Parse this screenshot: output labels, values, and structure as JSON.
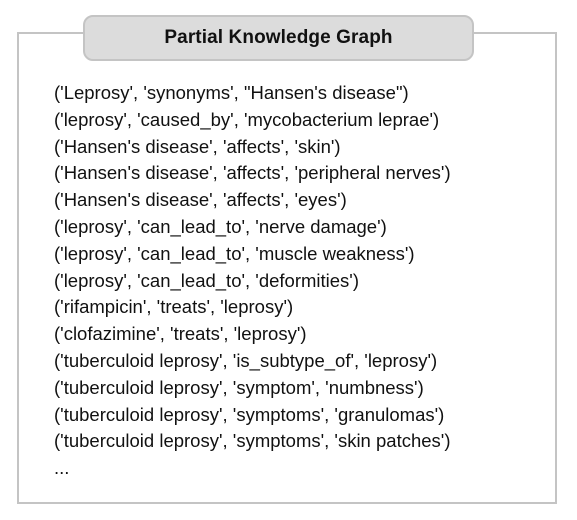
{
  "title": "Partial Knowledge Graph",
  "triples": [
    "('Leprosy', 'synonyms', \"Hansen's disease\")",
    "('leprosy', 'caused_by', 'mycobacterium leprae')",
    "('Hansen's disease', 'affects', 'skin')",
    "('Hansen's disease', 'affects', 'peripheral nerves')",
    "('Hansen's disease', 'affects', 'eyes')",
    "('leprosy', 'can_lead_to', 'nerve damage')",
    "('leprosy', 'can_lead_to', 'muscle weakness')",
    "('leprosy', 'can_lead_to', 'deformities')",
    "('rifampicin', 'treats', 'leprosy')",
    "('clofazimine', 'treats', 'leprosy')",
    "('tuberculoid leprosy', 'is_subtype_of', 'leprosy')",
    "('tuberculoid leprosy', 'symptom', 'numbness')",
    "('tuberculoid leprosy', 'symptoms', 'granulomas')",
    "('tuberculoid leprosy', 'symptoms', 'skin patches')",
    "..."
  ]
}
